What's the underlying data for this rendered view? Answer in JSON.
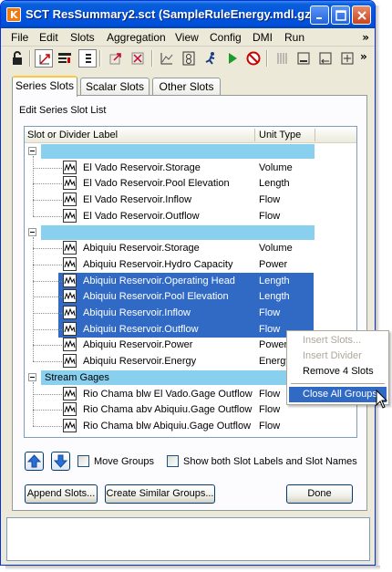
{
  "window": {
    "title": "SCT ResSummary2.sct (SampleRuleEnergy.mdl.gz)",
    "app_icon_letter": "K"
  },
  "menu": {
    "items": [
      "File",
      "Edit",
      "Slots",
      "Aggregation",
      "View",
      "Config",
      "DMI",
      "Run"
    ],
    "overflow": "»"
  },
  "tabs": [
    "Series Slots",
    "Scalar Slots",
    "Other Slots"
  ],
  "panel": {
    "label": "Edit Series Slot List",
    "col_label": "Slot or Divider Label",
    "col_unit": "Unit Type"
  },
  "groups": [
    {
      "divider": "",
      "rows": [
        {
          "label": "El Vado Reservoir.Storage",
          "unit": "Volume",
          "selected": false
        },
        {
          "label": "El Vado Reservoir.Pool Elevation",
          "unit": "Length",
          "selected": false
        },
        {
          "label": "El Vado Reservoir.Inflow",
          "unit": "Flow",
          "selected": false
        },
        {
          "label": "El Vado Reservoir.Outflow",
          "unit": "Flow",
          "selected": false
        }
      ]
    },
    {
      "divider": "",
      "rows": [
        {
          "label": "Abiquiu Reservoir.Storage",
          "unit": "Volume",
          "selected": false
        },
        {
          "label": "Abiquiu Reservoir.Hydro Capacity",
          "unit": "Power",
          "selected": false
        },
        {
          "label": "Abiquiu Reservoir.Operating Head",
          "unit": "Length",
          "selected": true
        },
        {
          "label": "Abiquiu Reservoir.Pool Elevation",
          "unit": "Length",
          "selected": true
        },
        {
          "label": "Abiquiu Reservoir.Inflow",
          "unit": "Flow",
          "selected": true
        },
        {
          "label": "Abiquiu Reservoir.Outflow",
          "unit": "Flow",
          "selected": true
        },
        {
          "label": "Abiquiu Reservoir.Power",
          "unit": "Power",
          "selected": false
        },
        {
          "label": "Abiquiu Reservoir.Energy",
          "unit": "Energy",
          "selected": false
        }
      ]
    },
    {
      "divider": "Stream Gages",
      "rows": [
        {
          "label": "Rio Chama blw El Vado.Gage Outflow",
          "unit": "Flow",
          "selected": false
        },
        {
          "label": "Rio Chama abv Abiquiu.Gage Outflow",
          "unit": "Flow",
          "selected": false
        },
        {
          "label": "Rio Chama blw Abiquiu.Gage Outflow",
          "unit": "Flow",
          "selected": false
        }
      ]
    }
  ],
  "context_menu": {
    "items": [
      {
        "label": "Insert Slots...",
        "state": "disabled"
      },
      {
        "label": "Insert Divider",
        "state": "disabled"
      },
      {
        "label": "Remove 4 Slots",
        "state": "enabled"
      },
      {
        "label": "Close All Groups",
        "state": "hover"
      }
    ]
  },
  "controls": {
    "move_groups": "Move Groups",
    "show_both": "Show both Slot Labels and Slot Names",
    "append": "Append Slots...",
    "create_similar": "Create Similar Groups...",
    "done": "Done"
  },
  "colors": {
    "selection": "#316ac5",
    "divider": "#89cfee",
    "titlebar": "#0054e3"
  }
}
